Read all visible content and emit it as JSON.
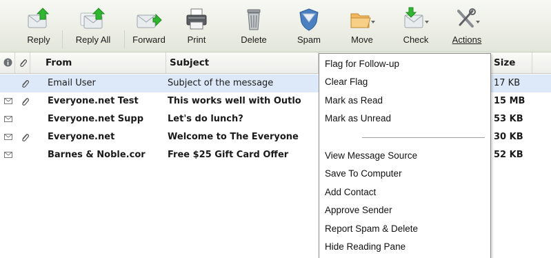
{
  "toolbar": {
    "buttons": [
      {
        "label": "Reply",
        "icon": "reply-icon"
      },
      {
        "label": "Reply All",
        "icon": "reply-all-icon"
      },
      {
        "label": "Forward",
        "icon": "forward-icon"
      },
      {
        "label": "Print",
        "icon": "printer-icon"
      },
      {
        "label": "Delete",
        "icon": "trash-icon"
      },
      {
        "label": "Spam",
        "icon": "spam-shield-icon"
      },
      {
        "label": "Move",
        "icon": "folder-move-icon"
      },
      {
        "label": "Check",
        "icon": "check-mail-icon"
      },
      {
        "label": "Actions",
        "icon": "tools-icon"
      }
    ]
  },
  "columns": {
    "from": "From",
    "subject": "Subject",
    "size": "Size"
  },
  "messages": [
    {
      "from": "Email User",
      "subject": "Subject of the message",
      "size": "17 KB",
      "unread": false,
      "attachment": true,
      "selected": true
    },
    {
      "from": "Everyone.net Test",
      "subject": "This works well with Outlo",
      "size": "15 MB",
      "unread": true,
      "attachment": true,
      "selected": false
    },
    {
      "from": "Everyone.net Supp",
      "subject": "Let's do lunch?",
      "size": "53 KB",
      "unread": true,
      "attachment": false,
      "selected": false
    },
    {
      "from": "Everyone.net",
      "subject": "Welcome to The Everyone",
      "size": "30 KB",
      "unread": true,
      "attachment": true,
      "selected": false
    },
    {
      "from": "Barnes & Noble.cor",
      "subject": "Free $25 Gift Card Offer",
      "size": "52 KB",
      "unread": true,
      "attachment": false,
      "selected": false
    }
  ],
  "actions_menu": {
    "group1": [
      "Flag for Follow-up",
      "Clear Flag",
      "Mark as Read",
      "Mark as Unread"
    ],
    "group2": [
      "View Message Source",
      "Save To Computer",
      "Add Contact",
      "Approve Sender",
      "Report Spam & Delete",
      "Hide Reading Pane"
    ]
  },
  "colors": {
    "accent_green": "#2fb52f",
    "selected_row": "#dde9f8",
    "toolbar_bg": "#eceee5"
  }
}
